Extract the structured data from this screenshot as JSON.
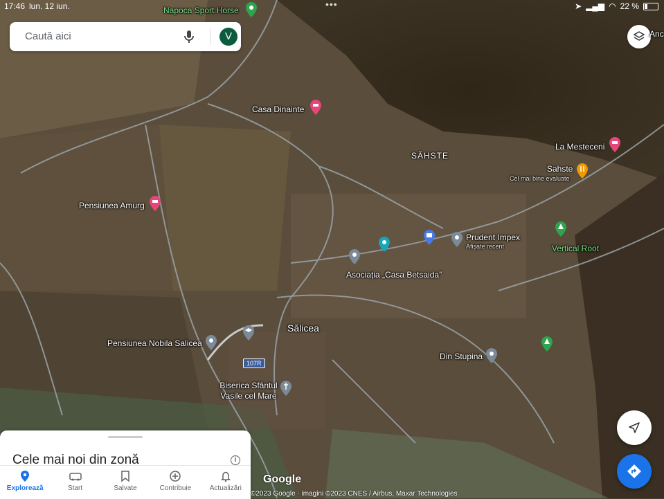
{
  "status_bar": {
    "time": "17:46",
    "date": "lun. 12 iun.",
    "battery": "22 %",
    "battery_level": 0.22
  },
  "search": {
    "placeholder": "Caută aici",
    "avatar_letter": "V"
  },
  "places": [
    {
      "name": "Napoca Sport Horse",
      "color": "green"
    },
    {
      "name": "Casa Dinainte",
      "color": "white"
    },
    {
      "name": "Pensiunea Amurg",
      "color": "white"
    },
    {
      "name": "SĂHSTE",
      "color": "white"
    },
    {
      "name": "La Mesteceni",
      "color": "white"
    },
    {
      "name": "Sahste",
      "color": "white",
      "sub": "Cel mai bine evaluate"
    },
    {
      "name": "Prudent Impex",
      "color": "white",
      "sub": "Afișate recent"
    },
    {
      "name": "Vertical Root",
      "color": "green"
    },
    {
      "name": "Asociația „Casa Betsaida”",
      "color": "white"
    },
    {
      "name": "Sălicea",
      "color": "white"
    },
    {
      "name": "Pensiunea Nobila Salicea",
      "color": "white"
    },
    {
      "name": "Din Stupina",
      "color": "white"
    },
    {
      "name": "Biserica Sfântul Vasile cel Mare",
      "color": "white"
    },
    {
      "name": "Anc",
      "color": "white"
    }
  ],
  "road_shield": "107R",
  "sheet": {
    "title": "Cele mai noi din zonă"
  },
  "nav": [
    {
      "label": "Explorează",
      "icon": "explore-pin-icon",
      "active": true
    },
    {
      "label": "Start",
      "icon": "car-icon",
      "active": false
    },
    {
      "label": "Salvate",
      "icon": "bookmark-icon",
      "active": false
    },
    {
      "label": "Contribuie",
      "icon": "add-circle-icon",
      "active": false
    },
    {
      "label": "Actualizări",
      "icon": "bell-icon",
      "active": false
    }
  ],
  "google_logo": "Google",
  "attribution": "©2023 Google · imagini ©2023 CNES / Airbus, Maxar Technologies",
  "colors": {
    "accent": "#1a73e8",
    "avatar": "#0b5b3e",
    "pin_pink": "#e8457a",
    "pin_grey": "#7a8a99"
  }
}
